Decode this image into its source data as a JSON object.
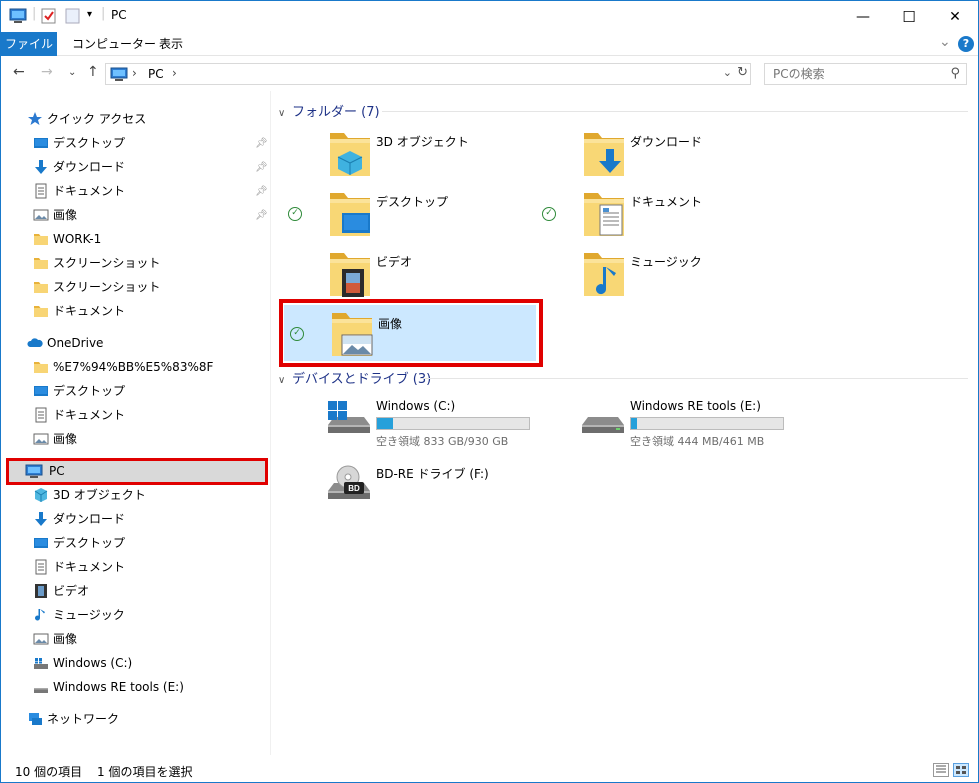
{
  "window": {
    "title": "PC",
    "minimize": "—",
    "maximize": "☐",
    "close": "✕"
  },
  "ribbon": {
    "tabs": [
      "ファイル",
      "コンピューター",
      "表示"
    ],
    "expand": "⌄",
    "help": "?"
  },
  "address": {
    "crumb": "PC",
    "search_placeholder": "PCの検索"
  },
  "nav": {
    "quick_access": "クイック アクセス",
    "quick_items": [
      "デスクトップ",
      "ダウンロード",
      "ドキュメント",
      "画像",
      "WORK-1",
      "スクリーンショット",
      "スクリーンショット",
      "ドキュメント"
    ],
    "onedrive": "OneDrive",
    "onedrive_items": [
      "%E7%94%BB%E5%83%8F",
      "デスクトップ",
      "ドキュメント",
      "画像"
    ],
    "pc": "PC",
    "pc_items": [
      "3D オブジェクト",
      "ダウンロード",
      "デスクトップ",
      "ドキュメント",
      "ビデオ",
      "ミュージック",
      "画像",
      "Windows (C:)",
      "Windows RE tools (E:)"
    ],
    "network": "ネットワーク"
  },
  "content": {
    "folders_header": "フォルダー (7)",
    "folders": [
      "3D オブジェクト",
      "ダウンロード",
      "デスクトップ",
      "ドキュメント",
      "ビデオ",
      "ミュージック",
      "画像"
    ],
    "drives_header": "デバイスとドライブ (3)",
    "drives": [
      {
        "name": "Windows (C:)",
        "free": "空き領域 833 GB/930 GB",
        "used_fraction": 0.104
      },
      {
        "name": "Windows RE tools (E:)",
        "free": "空き領域 444 MB/461 MB",
        "used_fraction": 0.037
      },
      {
        "name": "BD-RE ドライブ (F:)"
      }
    ],
    "bd_label": "BD"
  },
  "status": {
    "count": "10 個の項目",
    "selected": "1 個の項目を選択"
  },
  "colors": {
    "accent": "#1979ca",
    "selection": "#cce8ff",
    "highlight_box": "#e00000",
    "folder": "#f5c443"
  }
}
